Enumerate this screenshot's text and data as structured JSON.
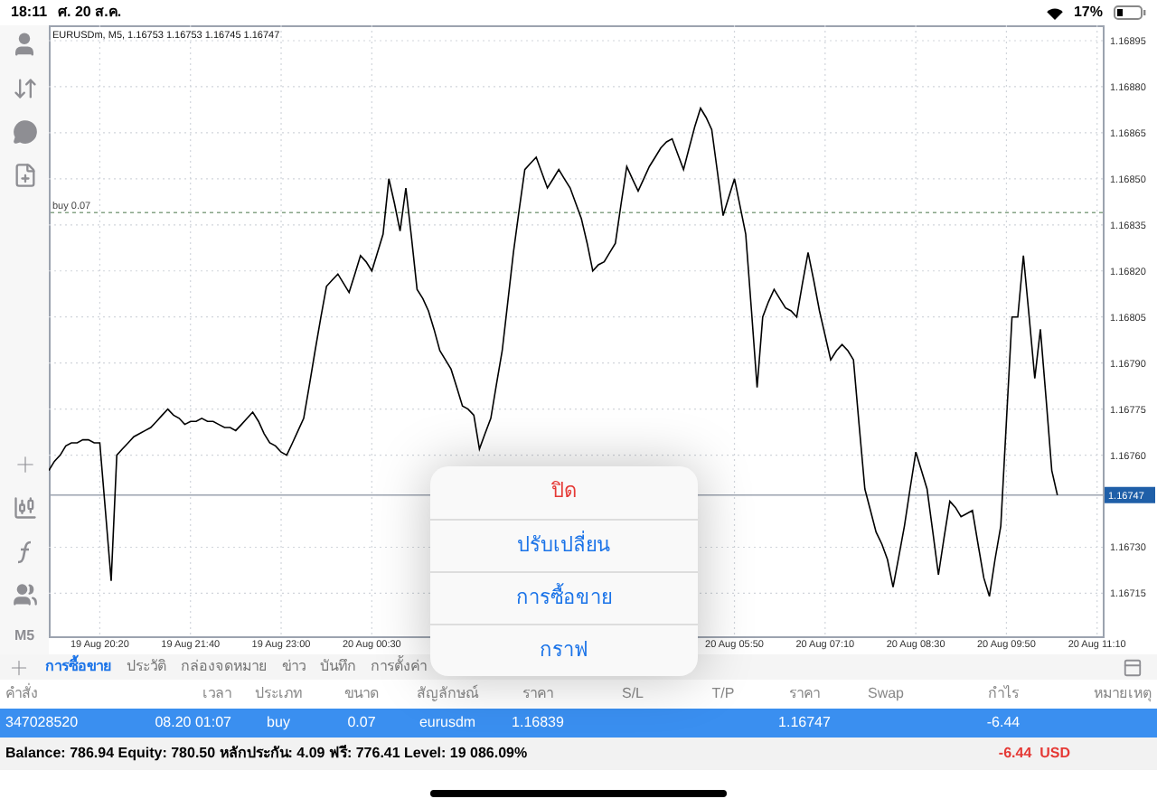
{
  "status_bar": {
    "time": "18:11",
    "date": "ศ. 20 ส.ค.",
    "battery": "17%"
  },
  "toolbar": {
    "timeframe": "M5"
  },
  "chart": {
    "chart_data": {
      "type": "line",
      "title": "EURUSDm, M5, 1.16753 1.16753 1.16745 1.16747",
      "categories": [
        null,
        null,
        null,
        null,
        null,
        null,
        null,
        null,
        null,
        "19 Aug 20:20",
        null,
        null,
        null,
        null,
        null,
        null,
        null,
        null,
        null,
        null,
        null,
        null,
        null,
        null,
        null,
        "19 Aug 21:40",
        null,
        null,
        null,
        null,
        null,
        null,
        null,
        null,
        null,
        null,
        null,
        null,
        null,
        null,
        null,
        "19 Aug 23:00",
        null,
        null,
        null,
        null,
        null,
        null,
        null,
        null,
        null,
        null,
        null,
        null,
        null,
        null,
        null,
        "20 Aug 00:30",
        null,
        null,
        null,
        null,
        null,
        null,
        null,
        null,
        null,
        null,
        null,
        null,
        null,
        null,
        null,
        null,
        null,
        null,
        null,
        null,
        null,
        null,
        null,
        null,
        null,
        null,
        null,
        null,
        null,
        null,
        null,
        null,
        null,
        null,
        null,
        null,
        null,
        null,
        null,
        null,
        null,
        null,
        null,
        null,
        null,
        null,
        null,
        null,
        null,
        null,
        null,
        null,
        null,
        null,
        null,
        null,
        null,
        null,
        null,
        null,
        null,
        null,
        null,
        "20 Aug 05:50",
        null,
        null,
        null,
        null,
        null,
        null,
        null,
        null,
        null,
        null,
        null,
        null,
        null,
        null,
        null,
        "20 Aug 07:10",
        null,
        null,
        null,
        null,
        null,
        null,
        null,
        null,
        null,
        null,
        null,
        null,
        null,
        null,
        null,
        "20 Aug 08:30",
        null,
        null,
        null,
        null,
        null,
        null,
        null,
        null,
        null,
        null,
        null,
        null,
        null,
        null,
        null,
        "20 Aug 09:50",
        null,
        null,
        null,
        null,
        null,
        null,
        null,
        null,
        null,
        null,
        null,
        null,
        null,
        null,
        null,
        "20 Aug 11:10"
      ],
      "series": [
        {
          "color": "#000000",
          "values": [
            1.16755,
            1.16758,
            1.1676,
            1.16763,
            1.16764,
            1.16764,
            1.16765,
            1.16765,
            1.16764,
            1.16764,
            1.16742,
            1.16719,
            1.1676,
            1.16762,
            1.16764,
            1.16766,
            1.16767,
            1.16768,
            1.16769,
            1.16771,
            1.16773,
            1.16775,
            1.16773,
            1.16772,
            1.1677,
            1.16771,
            1.16771,
            1.16772,
            1.16771,
            1.16771,
            1.1677,
            1.16769,
            1.16769,
            1.16768,
            1.1677,
            1.16772,
            1.16774,
            1.16771,
            1.16767,
            1.16764,
            1.16763,
            1.16761,
            1.1676,
            1.16764,
            1.16768,
            1.16772,
            1.16783,
            1.16794,
            1.16805,
            1.16815,
            1.16817,
            1.16819,
            1.16816,
            1.16813,
            1.16819,
            1.16825,
            1.16823,
            1.1682,
            1.16826,
            1.16832,
            1.1685,
            1.16842,
            1.16833,
            1.16847,
            1.16831,
            1.16814,
            1.16811,
            1.16807,
            1.16801,
            1.16794,
            1.16791,
            1.16788,
            1.16782,
            1.16776,
            1.16775,
            1.16773,
            1.16762,
            1.16767,
            1.16772,
            1.16783,
            1.16794,
            1.1681,
            1.16826,
            1.1684,
            1.16853,
            1.16855,
            1.16857,
            1.16852,
            1.16847,
            1.1685,
            1.16853,
            1.1685,
            1.16847,
            1.16842,
            1.16837,
            1.16829,
            1.1682,
            1.16822,
            1.16823,
            1.16826,
            1.16829,
            1.16842,
            1.16854,
            1.1685,
            1.16846,
            1.1685,
            1.16854,
            1.16857,
            1.1686,
            1.16862,
            1.16863,
            1.16858,
            1.16853,
            1.1686,
            1.16867,
            1.16873,
            1.1687,
            1.16866,
            1.16852,
            1.16838,
            1.16844,
            1.1685,
            1.16841,
            1.16832,
            1.16807,
            1.16782,
            1.16805,
            1.1681,
            1.16814,
            1.16811,
            1.16808,
            1.16807,
            1.16805,
            1.16816,
            1.16826,
            1.16817,
            1.16807,
            1.16799,
            1.16791,
            1.16794,
            1.16796,
            1.16794,
            1.16791,
            1.1677,
            1.16749,
            1.16742,
            1.16735,
            1.16731,
            1.16726,
            1.16717,
            1.16727,
            1.16737,
            1.16749,
            1.16761,
            1.16755,
            1.16749,
            1.16735,
            1.16721,
            1.16733,
            1.16745,
            1.16743,
            1.1674,
            1.16741,
            1.16742,
            1.16731,
            1.1672,
            1.16714,
            1.16726,
            1.16737,
            1.16771,
            1.16805,
            1.16805,
            1.16825,
            1.16805,
            1.16785,
            1.16801,
            1.16778,
            1.16755,
            1.16747,
            null,
            null,
            null,
            null,
            null,
            null,
            null
          ]
        }
      ],
      "ylim": [
        1.16701,
        1.169
      ],
      "yticks": [
        {
          "value": 1.16895,
          "label": "1.16895"
        },
        {
          "value": 1.1688,
          "label": "1.16880"
        },
        {
          "value": 1.16865,
          "label": "1.16865"
        },
        {
          "value": 1.1685,
          "label": "1.16850"
        },
        {
          "value": 1.16835,
          "label": "1.16835"
        },
        {
          "value": 1.1682,
          "label": "1.16820"
        },
        {
          "value": 1.16805,
          "label": "1.16805"
        },
        {
          "value": 1.1679,
          "label": "1.16790"
        },
        {
          "value": 1.16775,
          "label": "1.16775"
        },
        {
          "value": 1.1676,
          "label": "1.16760"
        },
        {
          "value": 1.1673,
          "label": "1.16730"
        },
        {
          "value": 1.16715,
          "label": "1.16715"
        }
      ],
      "grid": true,
      "ref_lines": [
        {
          "axis": "y",
          "value": 1.16839,
          "label": "buy 0.07"
        },
        {
          "axis": "y",
          "value": 1.16747,
          "label": "1.16747"
        }
      ]
    }
  },
  "tabs": [
    {
      "label": "การซื้อขาย",
      "selected": true
    },
    {
      "label": "ประวัติ",
      "selected": false
    },
    {
      "label": "กล่องจดหมาย",
      "selected": false
    },
    {
      "label": "ข่าว",
      "selected": false
    },
    {
      "label": "บันทึก",
      "selected": false
    },
    {
      "label": "การตั้งค่า",
      "selected": false
    }
  ],
  "table": {
    "columns": [
      "คำสั่ง",
      "เวลา",
      "ประเภท",
      "ขนาด",
      "สัญลักษณ์",
      "ราคา",
      "S/L",
      "T/P",
      "ราคา",
      "Swap",
      "กำไร",
      "หมายเหตุ"
    ],
    "rows": [
      {
        "selected": true,
        "cells": [
          "347028520",
          "08.20 01:07",
          "buy",
          "0.07",
          "eurusdm",
          "1.16839",
          null,
          null,
          "1.16747",
          null,
          "-6.44",
          null
        ]
      }
    ]
  },
  "summary": {
    "text": "Balance: 786.94 Equity: 780.50 หลักประกัน: 4.09 ฟรี: 776.41 Level: 19 086.09%",
    "profit": "-6.44  USD"
  },
  "action_sheet": {
    "items": [
      {
        "label": "ปิด",
        "kind": "destructive"
      },
      {
        "label": "ปรับเปลี่ยน",
        "kind": "default"
      },
      {
        "label": "การซื้อขาย",
        "kind": "default"
      },
      {
        "label": "กราฟ",
        "kind": "default"
      }
    ]
  }
}
